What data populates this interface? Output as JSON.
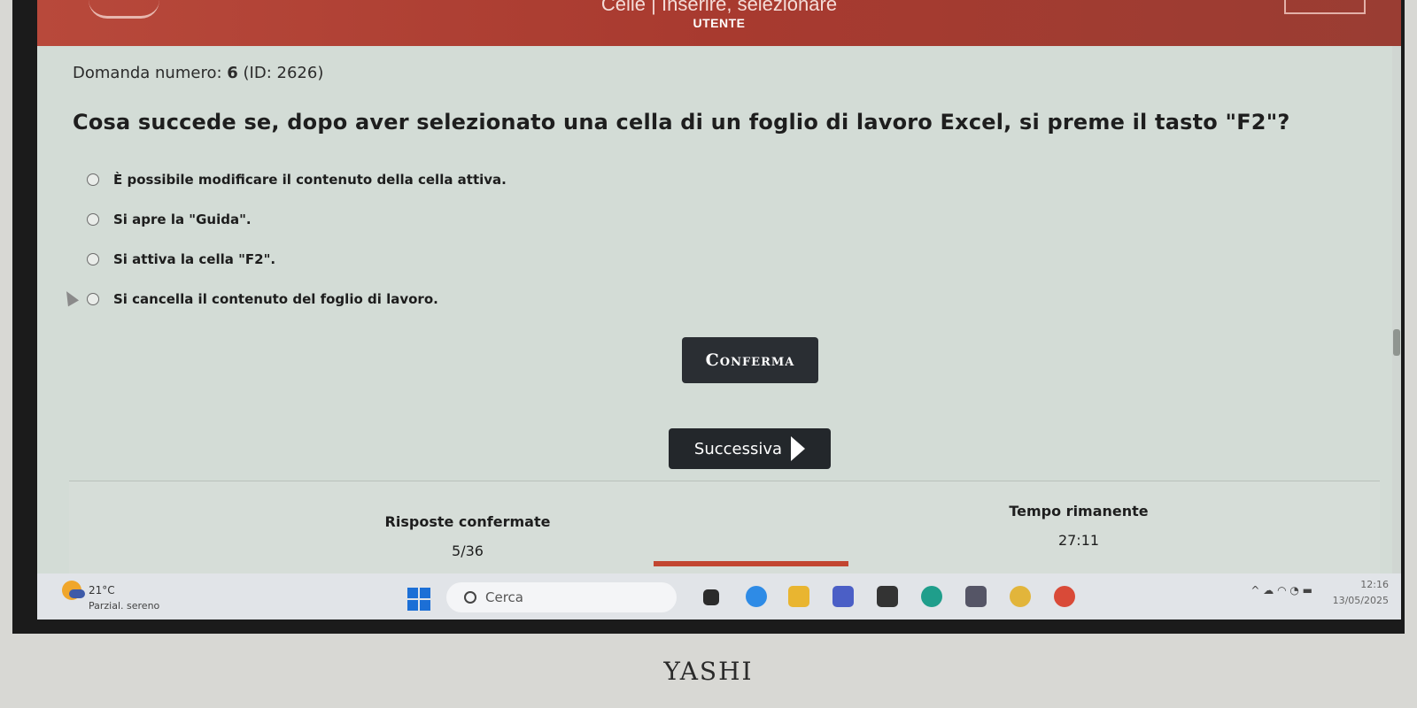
{
  "topbar": {
    "section_title": "Celle | Inserire, selezionare",
    "user_label": "UTENTE"
  },
  "question": {
    "number_label": "Domanda numero:",
    "number": "6",
    "id_label": "(ID: 2626)",
    "text": "Cosa succede se, dopo aver selezionato una cella di un foglio di lavoro Excel, si preme il tasto \"F2\"?"
  },
  "answers": [
    {
      "text": "È possibile modificare il contenuto della cella attiva."
    },
    {
      "text": "Si apre la \"Guida\"."
    },
    {
      "text": "Si attiva la cella \"F2\"."
    },
    {
      "text": "Si cancella il contenuto del foglio di lavoro."
    }
  ],
  "buttons": {
    "confirm": "Conferma",
    "next": "Successiva"
  },
  "status": {
    "confirmed_label": "Risposte confermate",
    "confirmed_value": "5/36",
    "time_label": "Tempo rimanente",
    "time_value": "27:11"
  },
  "taskbar": {
    "weather_temp": "21°C",
    "weather_condition": "Parzial. sereno",
    "search_placeholder": "Cerca",
    "time": "12:16",
    "date": "13/05/2025"
  },
  "device_brand": "YASHI",
  "colors": {
    "header": "#b8493b",
    "button": "#2a2e33",
    "progress": "#c24530"
  }
}
